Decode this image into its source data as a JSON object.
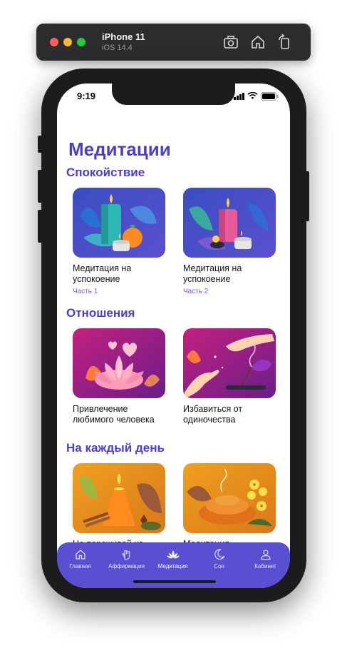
{
  "simulator": {
    "device": "iPhone 11",
    "os": "iOS 14.4",
    "icons": [
      "camera-icon",
      "home-icon",
      "rotate-icon"
    ]
  },
  "status_bar": {
    "time": "9:19"
  },
  "page": {
    "title": "Медитации"
  },
  "sections": [
    {
      "title": "Спокойствие",
      "cards": [
        {
          "title": "Медитация на успокоение",
          "subtitle": "Часть 1"
        },
        {
          "title": "Медитация на успокоение",
          "subtitle": "Часть 2"
        }
      ]
    },
    {
      "title": "Отношения",
      "cards": [
        {
          "title": "Привлечение любимого человека",
          "subtitle": ""
        },
        {
          "title": "Избавиться от одиночества",
          "subtitle": ""
        }
      ]
    },
    {
      "title": "На каждый день",
      "cards": [
        {
          "title": "Не переживай из",
          "subtitle": ""
        },
        {
          "title": "Медитация",
          "subtitle": ""
        }
      ]
    }
  ],
  "tabbar": {
    "items": [
      {
        "label": "Главная",
        "icon": "home-icon"
      },
      {
        "label": "Аффирмация",
        "icon": "palm-icon"
      },
      {
        "label": "Медитация",
        "icon": "lotus-icon",
        "active": true
      },
      {
        "label": "Сон",
        "icon": "moon-icon"
      },
      {
        "label": "Кабинет",
        "icon": "person-icon"
      }
    ]
  },
  "colors": {
    "accent": "#4a3fc7",
    "tabbar": "#5b4fd1",
    "subtitle": "#6a63d8"
  }
}
